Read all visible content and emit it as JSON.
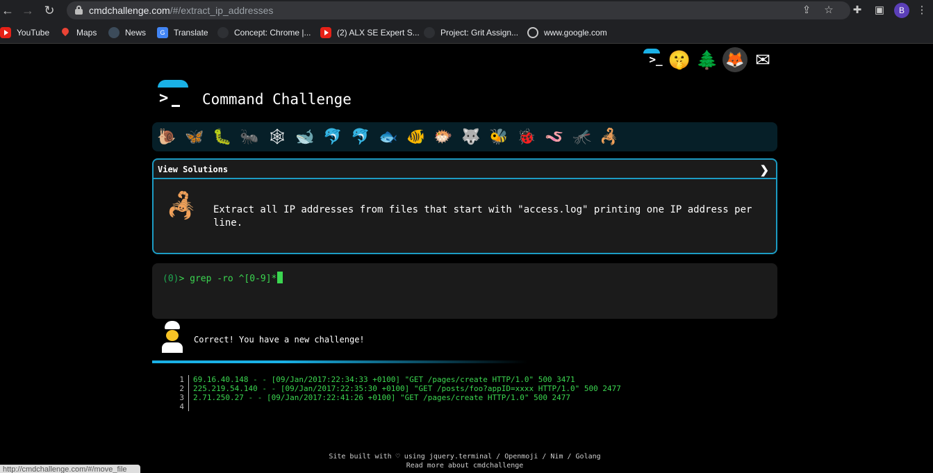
{
  "browser": {
    "url_host": "cmdchallenge.com",
    "url_path": "/#/extract_ip_addresses",
    "profile_initial": "B",
    "bookmarks": [
      {
        "label": "YouTube"
      },
      {
        "label": "Maps"
      },
      {
        "label": "News"
      },
      {
        "label": "Translate"
      },
      {
        "label": "Concept: Chrome |..."
      },
      {
        "label": "(2) ALX SE Expert S..."
      },
      {
        "label": "Project: Grit Assign..."
      },
      {
        "label": "www.google.com"
      }
    ],
    "status_url": "http://cmdchallenge.com/#/move_file"
  },
  "header": {
    "title": "Command Challenge",
    "top_icons": [
      "terminal-logo-icon",
      "shushing-face-icon",
      "tree-icon",
      "gitlab-icon",
      "envelope-icon"
    ]
  },
  "challenge_icons": [
    "snail",
    "butterfly",
    "caterpillar",
    "ant",
    "spider-web",
    "whale",
    "dolphin",
    "dolphin",
    "fish",
    "tropical-fish",
    "blowfish",
    "wolf",
    "bee",
    "ladybug",
    "worm",
    "mosquito",
    "scorpion"
  ],
  "solutions": {
    "label": "View Solutions",
    "toggle": "❯",
    "task": "Extract all IP addresses from files that start with \"access.log\" printing one IP address per line."
  },
  "terminal": {
    "exit_code": "(0)",
    "prompt": "> ",
    "command": "grep -ro ^[0-9]*"
  },
  "feedback": {
    "message": "Correct! You have a new challenge!"
  },
  "output": {
    "lines": [
      {
        "n": "1",
        "text": "69.16.40.148 - - [09/Jan/2017:22:34:33 +0100] \"GET /pages/create HTTP/1.0\" 500 3471"
      },
      {
        "n": "2",
        "text": "225.219.54.140 - - [09/Jan/2017:22:35:30 +0100] \"GET /posts/foo?appID=xxxx HTTP/1.0\" 500 2477"
      },
      {
        "n": "3",
        "text": "2.71.250.27 - - [09/Jan/2017:22:41:26 +0100] \"GET /pages/create HTTP/1.0\" 500 2477"
      },
      {
        "n": "4",
        "text": ""
      }
    ]
  },
  "footer": {
    "line1": "Site built with ♡ using jquery.terminal / Openmoji / Nim / Golang",
    "line2": "Read more about cmdchallenge"
  }
}
